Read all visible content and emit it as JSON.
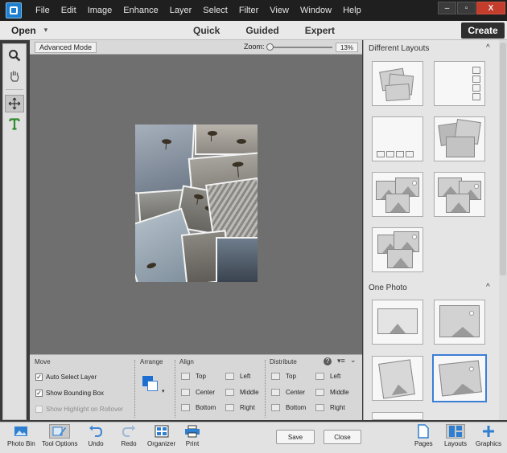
{
  "menubar": {
    "items": [
      "File",
      "Edit",
      "Image",
      "Enhance",
      "Layer",
      "Select",
      "Filter",
      "View",
      "Window",
      "Help"
    ]
  },
  "window_controls": {
    "minimize": "–",
    "maximize": "▫",
    "close": "X"
  },
  "modebar": {
    "open_label": "Open",
    "modes": [
      "Quick",
      "Guided",
      "Expert"
    ],
    "create_label": "Create"
  },
  "tool_options": {
    "advanced_mode_label": "Advanced Mode",
    "zoom_label": "Zoom:",
    "zoom_value": "13%",
    "zoom_fraction": 0.13
  },
  "options_panel": {
    "move_title": "Move",
    "checkboxes": [
      {
        "label": "Auto Select Layer",
        "checked": true,
        "enabled": true
      },
      {
        "label": "Show Bounding Box",
        "checked": true,
        "enabled": true
      },
      {
        "label": "Show Highlight on Rollover",
        "checked": false,
        "enabled": false
      }
    ],
    "arrange_title": "Arrange",
    "align_title": "Align",
    "align_col1": [
      "Top",
      "Center",
      "Bottom"
    ],
    "align_col2": [
      "Left",
      "Middle",
      "Right"
    ],
    "distribute_title": "Distribute",
    "distribute_col1": [
      "Top",
      "Center",
      "Bottom"
    ],
    "distribute_col2": [
      "Left",
      "Middle",
      "Right"
    ]
  },
  "right_panel": {
    "section1_title": "Different Layouts",
    "section2_title": "One Photo"
  },
  "bottombar": {
    "photo_bin": "Photo Bin",
    "tool_options": "Tool Options",
    "undo": "Undo",
    "redo": "Redo",
    "organizer": "Organizer",
    "print": "Print",
    "save": "Save",
    "close": "Close",
    "pages": "Pages",
    "layouts": "Layouts",
    "graphics": "Graphics"
  },
  "colors": {
    "accent": "#3b7ed6",
    "menubar_bg": "#1f1f1f",
    "close_button": "#c43c2c"
  }
}
